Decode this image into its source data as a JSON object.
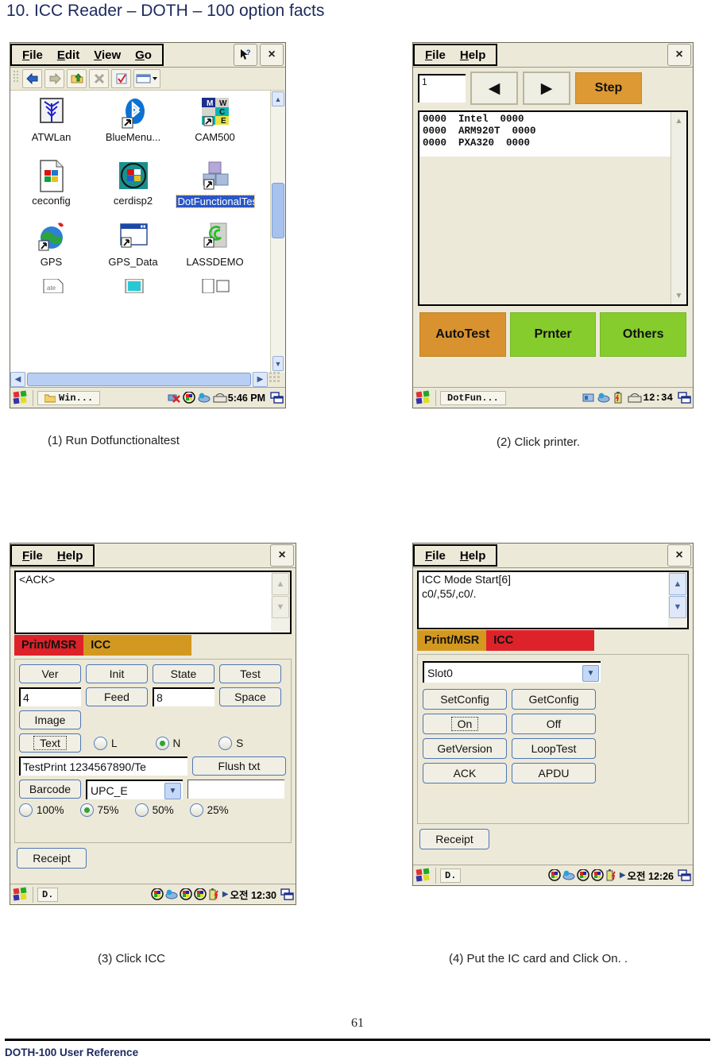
{
  "document": {
    "title": "10. ICC Reader – DOTH – 100 option facts",
    "page_number": "61",
    "footer": "DOTH-100 User Reference"
  },
  "captions": {
    "step1": "(1) Run Dotfunctionaltest",
    "step2": "(2) Click printer.",
    "step3": "(3) Click ICC",
    "step4": "(4) Put the IC card and Click On. ."
  },
  "window1": {
    "menu": [
      "File",
      "Edit",
      "View",
      "Go"
    ],
    "title_buttons": [
      "help-cursor",
      "close"
    ],
    "close_label": "×",
    "help_label": "?",
    "icons": [
      {
        "label": "ATWLan",
        "art": "antenna",
        "selected": false
      },
      {
        "label": "BlueMenu...",
        "art": "bluetooth",
        "selected": false
      },
      {
        "label": "CAM500",
        "art": "cam500",
        "selected": false
      },
      {
        "label": "ceconfig",
        "art": "cedoc",
        "selected": false
      },
      {
        "label": "cerdisp2",
        "art": "cerdisp",
        "selected": false
      },
      {
        "label": "DotFunctionalTest",
        "art": "blocks",
        "selected": true
      },
      {
        "label": "GPS",
        "art": "globe",
        "selected": false
      },
      {
        "label": "GPS_Data",
        "art": "window",
        "selected": false
      },
      {
        "label": "LASSDEMO",
        "art": "swirl",
        "selected": false
      }
    ],
    "taskbar": {
      "item": "Win...",
      "clock": "5:46 PM"
    }
  },
  "window2": {
    "menu": [
      "File",
      "Help"
    ],
    "close_label": "×",
    "step_index": "1",
    "prev_label": "◀",
    "next_label": "▶",
    "step_label": "Step",
    "list_lines": [
      "0000  Intel  0000",
      "0000  ARM920T  0000",
      "0000  PXA320  0000"
    ],
    "buttons": [
      {
        "label": "AutoTest",
        "style": "orange"
      },
      {
        "label": "Prnter",
        "style": "green"
      },
      {
        "label": "Others",
        "style": "green"
      }
    ],
    "taskbar": {
      "item": "DotFun...",
      "clock": "12:34"
    }
  },
  "window3": {
    "menu": [
      "File",
      "Help"
    ],
    "close_label": "×",
    "terminal_text": "<ACK>",
    "tabs": [
      {
        "label": "Print/MSR",
        "active": true
      },
      {
        "label": "ICC",
        "active": false
      }
    ],
    "row1": [
      "Ver",
      "Init",
      "State",
      "Test"
    ],
    "row2": {
      "field1": "4",
      "feed": "Feed",
      "field2": "8",
      "space": "Space"
    },
    "image_button": "Image",
    "text_button": "Text",
    "size_radios": [
      {
        "label": "L",
        "selected": false
      },
      {
        "label": "N",
        "selected": true
      },
      {
        "label": "S",
        "selected": false
      }
    ],
    "print_text": "TestPrint 1234567890/Te",
    "flush_button": "Flush txt",
    "barcode_button": "Barcode",
    "barcode_type": "UPC_E",
    "barcode_value": "",
    "percent_radios": [
      {
        "label": "100%",
        "selected": false
      },
      {
        "label": "75%",
        "selected": true
      },
      {
        "label": "50%",
        "selected": false
      },
      {
        "label": "25%",
        "selected": false
      }
    ],
    "receipt_button": "Receipt",
    "taskbar": {
      "item": "D.",
      "clock": "오전 12:30"
    }
  },
  "window4": {
    "menu": [
      "File",
      "Help"
    ],
    "close_label": "×",
    "terminal_lines": [
      "ICC Mode Start[6]",
      "c0/,55/,c0/."
    ],
    "tabs": [
      {
        "label": "Print/MSR",
        "active": false
      },
      {
        "label": "ICC",
        "active": true
      }
    ],
    "slot": "Slot0",
    "buttons": [
      [
        "SetConfig",
        "GetConfig"
      ],
      [
        "On",
        "Off"
      ],
      [
        "GetVersion",
        "LoopTest"
      ],
      [
        "ACK",
        "APDU"
      ]
    ],
    "focused_button": "On",
    "receipt_button": "Receipt",
    "taskbar": {
      "item": "D.",
      "clock": "오전 12:26"
    }
  },
  "colors": {
    "title_navy": "#1c2a5e",
    "tab_red": "#dd2229",
    "tab_gold": "#d3981f",
    "btn_orange": "#d8922f",
    "btn_green": "#86cc2d",
    "selection_blue": "#2a56c6"
  }
}
